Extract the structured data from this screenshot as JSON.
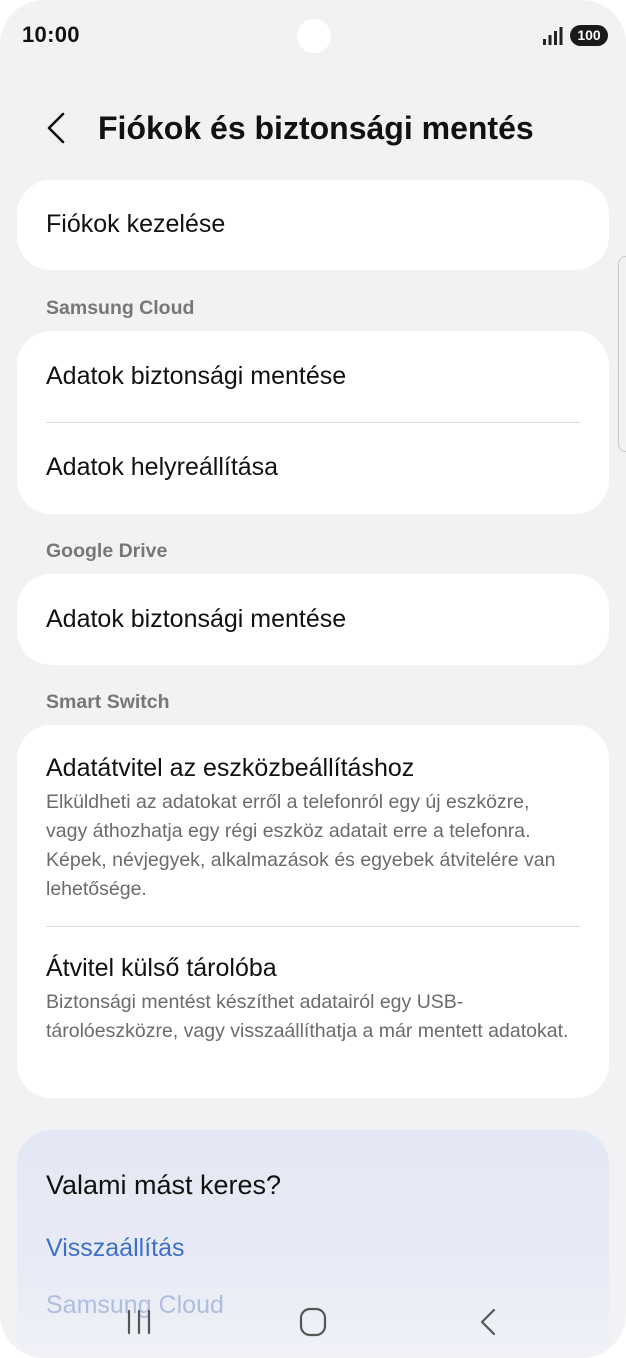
{
  "status": {
    "time": "10:00",
    "battery": "100"
  },
  "header": {
    "title": "Fiókok és biztonsági mentés"
  },
  "accounts": {
    "manage_label": "Fiókok kezelése"
  },
  "samsung_cloud": {
    "label": "Samsung Cloud",
    "backup_label": "Adatok biztonsági mentése",
    "restore_label": "Adatok helyreállítása"
  },
  "google_drive": {
    "label": "Google Drive",
    "backup_label": "Adatok biztonsági mentése"
  },
  "smart_switch": {
    "label": "Smart Switch",
    "transfer_title": "Adatátvitel az eszközbeállításhoz",
    "transfer_desc": "Elküldheti az adatokat erről a telefonról egy új eszközre, vagy áthozhatja egy régi eszköz adatait erre a telefonra. Képek, névjegyek, alkalmazások és egyebek átvitelére van lehetősége.",
    "external_title": "Átvitel külső tárolóba",
    "external_desc": "Biztonsági mentést készíthet adatairól egy USB-tárolóeszközre, vagy visszaállíthatja a már mentett adatokat."
  },
  "search_more": {
    "title": "Valami mást keres?",
    "links": [
      "Visszaállítás",
      "Samsung Cloud"
    ]
  },
  "icons": {
    "back": "chevron-left-icon",
    "signal": "signal-icon",
    "nav_recents": "recents-icon",
    "nav_home": "home-icon",
    "nav_back": "back-icon"
  },
  "colors": {
    "link": "#3e6fc9",
    "background": "#f2f2f4",
    "card": "#ffffff"
  }
}
